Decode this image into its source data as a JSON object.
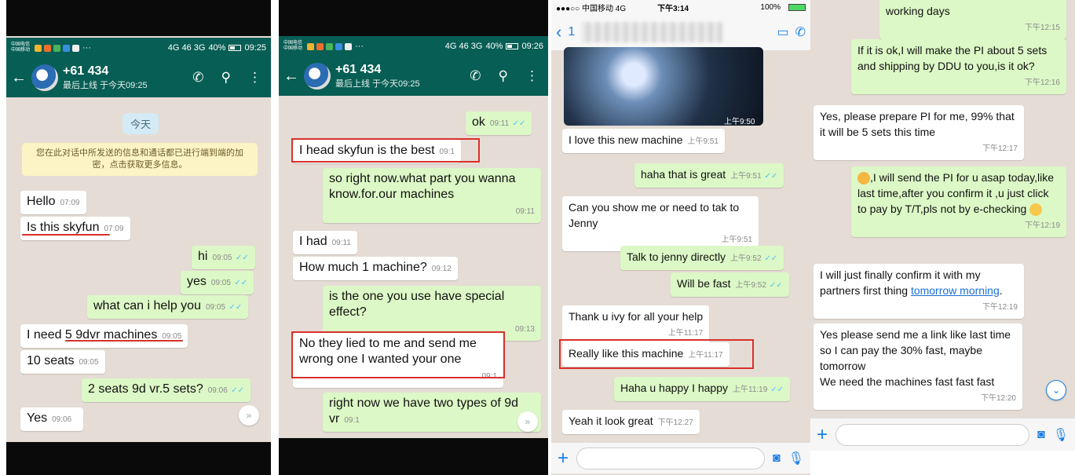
{
  "panel1": {
    "status": {
      "carrier": "中国电信 中国移动",
      "dots": "···",
      "network": "4G 46 3G",
      "battery": "40%",
      "time": "09:25"
    },
    "header": {
      "name": "+61 434",
      "last_seen": "最后上线 于今天09:25"
    },
    "date_pill": "今天",
    "notice": "您在此对话中所发送的信息和通话都已进行端到端的加密，点击获取更多信息。",
    "messages": [
      {
        "text": "Hello",
        "time": "07:09"
      },
      {
        "text": "Is this skyfun",
        "time": "07:09"
      },
      {
        "text": "hi",
        "time": "09:05"
      },
      {
        "text": "yes",
        "time": "09:05"
      },
      {
        "text": "what can i help you",
        "time": "09:05"
      },
      {
        "text": "I need 5 9dvr machines",
        "time": "09:05"
      },
      {
        "text": "10 seats",
        "time": "09:05"
      },
      {
        "text": "2 seats 9d vr.5 sets?",
        "time": "09:06"
      },
      {
        "text": "Yes",
        "time": "09:06"
      }
    ]
  },
  "panel2": {
    "status": {
      "carrier": "中国电信 中国移动",
      "dots": "···",
      "network": "4G 46 3G",
      "battery": "40%",
      "time": "09:26"
    },
    "header": {
      "name": "+61 434",
      "last_seen": "最后上线 于今天09:25"
    },
    "messages": [
      {
        "text": "ok",
        "time": "09:11"
      },
      {
        "text": "I head skyfun is the best",
        "time": "09:1"
      },
      {
        "text": "so right now.what part you wanna know.for.our machines",
        "time": "09:11"
      },
      {
        "text": "I had",
        "time": "09:11"
      },
      {
        "text": "How much 1 machine?",
        "time": "09:12"
      },
      {
        "text": "is the one you use have special effect?",
        "time": "09:13"
      },
      {
        "text": "No they lied to me and send me wrong one I wanted your one",
        "time": "09:1"
      },
      {
        "text": "right now we have two types of 9d vr",
        "time": "09:1"
      }
    ]
  },
  "panel3": {
    "status": {
      "signal": "●●●○○ 中国移动 4G",
      "time": "下午3:14",
      "battery": "100%"
    },
    "header": {
      "back_count": "1"
    },
    "photo_time": "上午9:50",
    "messages": [
      {
        "text": "I love this new machine",
        "time": "上午9:51"
      },
      {
        "text": "haha that is great",
        "time": "上午9:51"
      },
      {
        "text": "Can you show me or need to tak to Jenny",
        "time": "上午9:51"
      },
      {
        "text": "Talk to jenny directly",
        "time": "上午9:52"
      },
      {
        "text": "Will be fast",
        "time": "上午9:52"
      },
      {
        "text": "Thank u ivy for all your help",
        "time": "上午11:17"
      },
      {
        "text": "Really like this machine",
        "time": "上午11:17"
      },
      {
        "text": "Haha u happy I happy",
        "time": "上午11:19"
      },
      {
        "text": "Yeah it look great",
        "time": "下午12:27"
      }
    ]
  },
  "panel4": {
    "messages": [
      {
        "text": "working days",
        "time": "下午12:15"
      },
      {
        "text": "If it is ok,I will make the PI about 5 sets and shipping by DDU to you,is it ok?",
        "time": "下午12:16"
      },
      {
        "text": "Yes, please prepare PI for me, 99% that it will be 5 sets this time",
        "time": "下午12:17"
      },
      {
        "text": ",I will send the PI for u asap today,like last time,after you confirm it ,u just click to pay by T/T,pls not by e-checking",
        "time": "下午12:19"
      },
      {
        "text_a": "I will just finally confirm it with my partners first thing ",
        "link": "tomorrow morning",
        "text_b": ".",
        "time": "下午12:19"
      },
      {
        "text": "Yes please send me a link like last time so I can pay the 30% fast, maybe tomorrow\nWe need the machines fast fast fast",
        "time": "下午12:20"
      }
    ]
  }
}
